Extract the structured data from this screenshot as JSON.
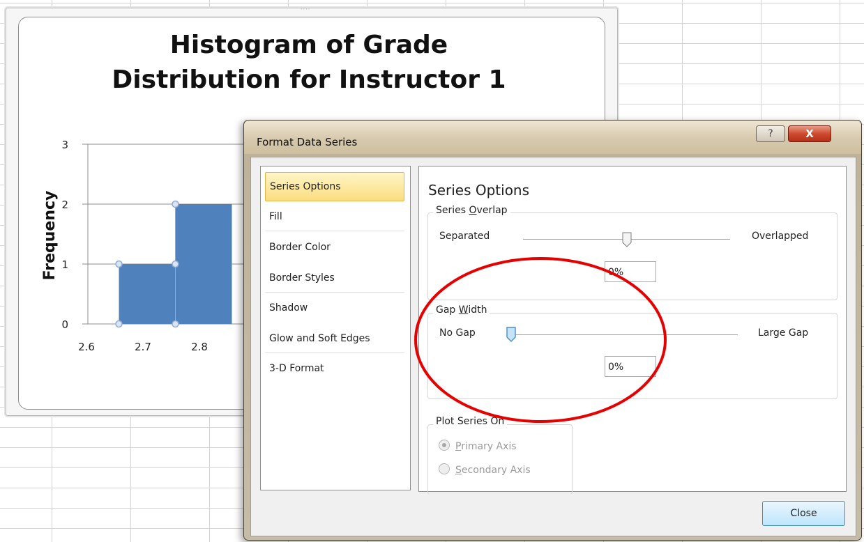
{
  "chart": {
    "title": "Histogram of Grade\nDistribution for Instructor 1"
  },
  "chart_data": {
    "type": "area",
    "title": "Histogram of Grade Distribution for Instructor 1",
    "xlabel": "",
    "ylabel": "Frequency",
    "x_tick_labels": [
      "2.6",
      "2.7",
      "2.8"
    ],
    "y_tick_labels": [
      "0",
      "1",
      "2",
      "3"
    ],
    "ylim": [
      0,
      3
    ],
    "xlim": [
      2.55,
      2.85
    ],
    "series": [
      {
        "x": [
          2.65,
          2.65,
          2.75,
          2.75,
          2.85
        ],
        "y": [
          0,
          1,
          1,
          2,
          2
        ]
      }
    ],
    "grid": true,
    "colors": {
      "fill": "#4f81bd",
      "marker_stroke": "#8eaad3"
    }
  },
  "dialog": {
    "title": "Format Data Series",
    "help_glyph": "?",
    "close_glyph": "X",
    "nav": [
      {
        "label": "Series Options",
        "selected": true
      },
      {
        "label": "Fill"
      },
      {
        "label": "Border Color"
      },
      {
        "label": "Border Styles"
      },
      {
        "label": "Shadow"
      },
      {
        "label": "Glow and Soft Edges"
      },
      {
        "label": "3-D Format"
      }
    ],
    "panel_title": "Series Options",
    "overlap": {
      "group_label_pre": "Series ",
      "group_label_key": "O",
      "group_label_post": "verlap",
      "left_label": "Separated",
      "right_label": "Overlapped",
      "value": "0%",
      "slider_fraction": 0.5
    },
    "gap": {
      "group_label_pre": "Gap ",
      "group_label_key": "W",
      "group_label_post": "idth",
      "left_label": "No Gap",
      "right_label": "Large Gap",
      "value": "0%",
      "slider_fraction": 0.0
    },
    "plot_series_on": {
      "group_label": "Plot Series On",
      "primary_key": "P",
      "primary_rest": "rimary Axis",
      "secondary_key": "S",
      "secondary_rest": "econdary Axis",
      "selected": "primary"
    },
    "close_label": "Close"
  },
  "colors": {
    "annotation": "#e60000",
    "selection": "#fbdd7f",
    "slider_active": "#5a9fd4"
  }
}
